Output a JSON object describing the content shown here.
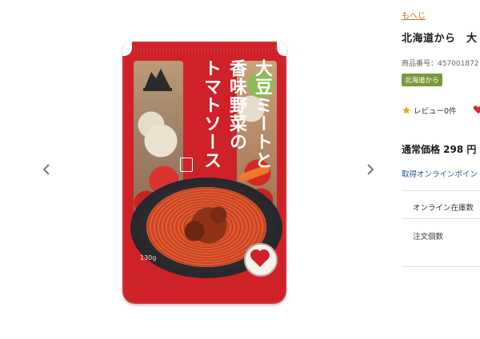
{
  "gallery": {
    "prev_icon": "chevron-left-icon",
    "next_icon": "chevron-right-icon",
    "product_package": {
      "title_lines": [
        "大豆ミートと",
        "香味野菜の",
        "トマトソース"
      ],
      "net_weight": "130g",
      "badge_text": "大豆"
    }
  },
  "panel": {
    "breadcrumb": "もへじ",
    "title": "北海道から　大",
    "product_code": "商品番号：457001872",
    "brand_tag": "北海道から",
    "review": {
      "icon": "star-icon",
      "label": "レビュー0件"
    },
    "favorite_icon": "heart-icon",
    "price": "通常価格 298 円",
    "points_link": "取得オンラインポイン",
    "stock_label": "オンライン在庫数",
    "quantity_label": "注文個数"
  },
  "colors": {
    "accent_orange": "#d8680f",
    "package_red": "#cf2228",
    "brand_green": "#7a9a3a",
    "link_blue": "#2a58a0",
    "star": "#f2a20c"
  }
}
